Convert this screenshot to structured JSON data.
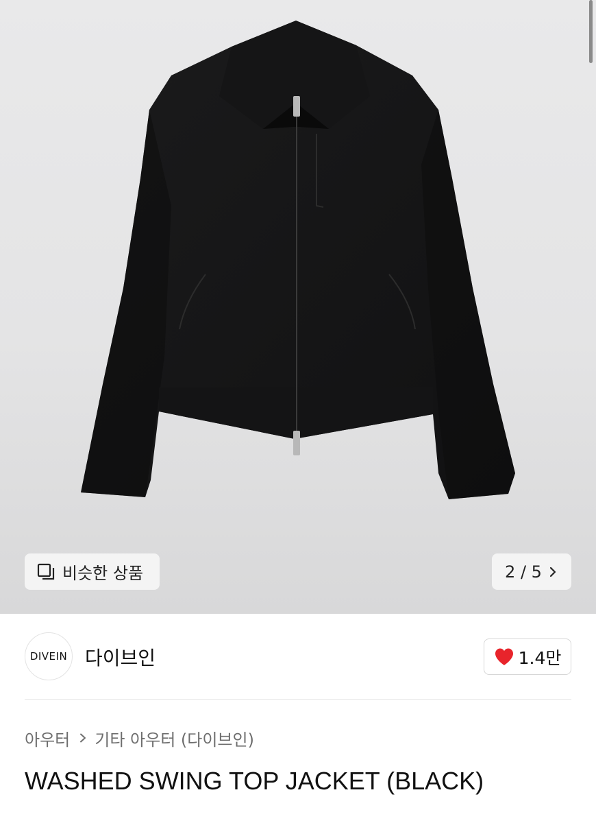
{
  "gallery": {
    "similar_label": "비슷한 상품",
    "counter": "2 / 5",
    "image_subject": "black zip-up jacket"
  },
  "brand": {
    "logo_text": "DIVEIN",
    "name": "다이브인",
    "likes": "1.4만"
  },
  "breadcrumb": {
    "category": "아우터",
    "subcategory": "기타 아우터 (다이브인)"
  },
  "product": {
    "title": "WASHED SWING TOP JACKET (BLACK)"
  },
  "colors": {
    "heart": "#e8242b",
    "text": "#111111",
    "muted": "#6e6e6e"
  }
}
